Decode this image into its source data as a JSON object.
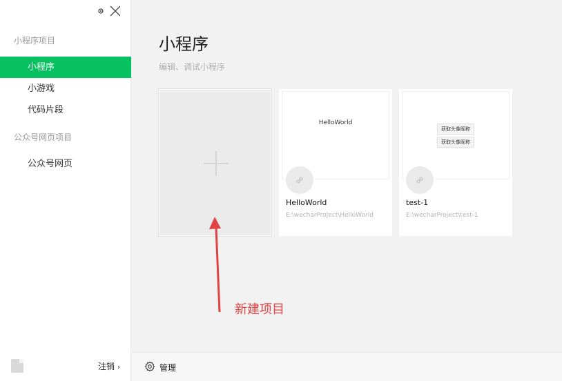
{
  "sidebar": {
    "groups": [
      {
        "title": "小程序项目",
        "items": [
          {
            "label": "小程序"
          },
          {
            "label": "小游戏"
          },
          {
            "label": "代码片段"
          }
        ]
      },
      {
        "title": "公众号网页项目",
        "items": [
          {
            "label": "公众号网页"
          }
        ]
      }
    ],
    "footer": {
      "logout_label": "注销",
      "chevron": "›"
    }
  },
  "main": {
    "title": "小程序",
    "subtitle": "编辑、调试小程序",
    "projects": [
      {
        "name": "HelloWorld",
        "path": "E:\\wecharProject\\HelloWorld",
        "preview_text": "HelloWorld"
      },
      {
        "name": "test-1",
        "path": "E:\\wecharProject\\test-1",
        "preview_buttons": [
          "获取头像昵称",
          "获取头像昵称"
        ]
      }
    ]
  },
  "annotation": {
    "label": "新建项目",
    "color": "#e04343"
  },
  "footer": {
    "manage_label": "管理"
  },
  "colors": {
    "accent": "#07c160"
  },
  "icons": [
    "settings-icon",
    "close-icon",
    "plus-icon",
    "miniprogram-logo-icon",
    "gear-icon",
    "avatar"
  ]
}
